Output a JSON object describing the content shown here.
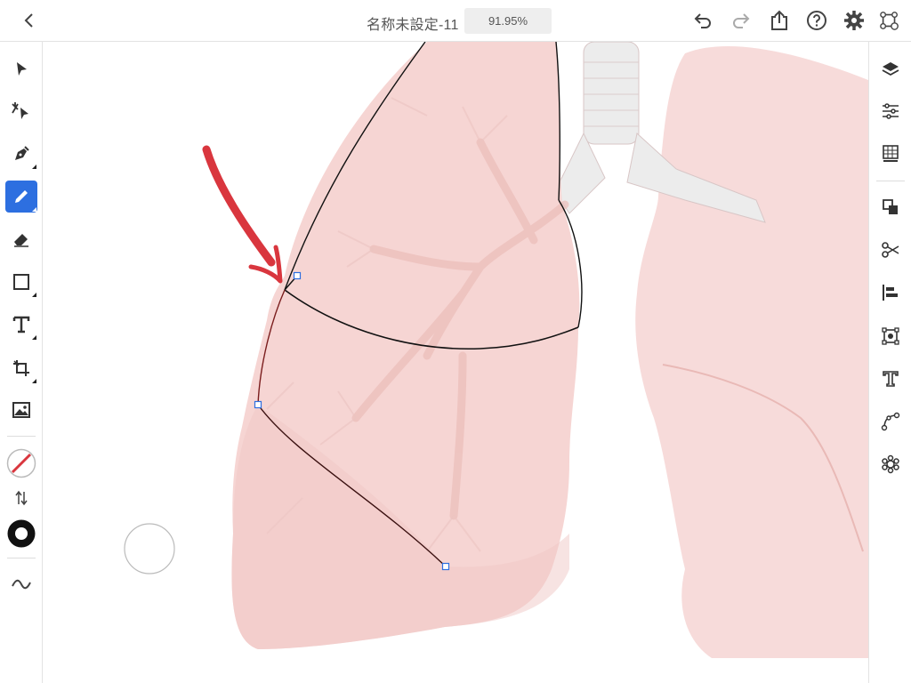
{
  "header": {
    "document_title": "名称未設定-11",
    "zoom_level": "91.95%"
  },
  "icons": {
    "top": [
      "back-chevron-icon",
      "undo-icon",
      "redo-icon",
      "share-icon",
      "help-icon",
      "settings-gear-icon",
      "touch-shortcut-icon"
    ],
    "left": [
      "selection-arrow-icon",
      "direct-selection-icon",
      "pen-icon",
      "pencil-icon",
      "eraser-icon",
      "rectangle-icon",
      "type-icon",
      "shaper-icon",
      "image-icon",
      "stroke-swatch-icon",
      "swap-colors-icon",
      "fill-swatch-icon",
      "stroke-width-icon"
    ],
    "right": [
      "layers-icon",
      "properties-icon",
      "transform-grid-icon",
      "arrange-icon",
      "pathfinder-scissors-icon",
      "align-icon",
      "trace-image-icon",
      "type-panel-icon",
      "path-icon",
      "repeat-icon"
    ]
  },
  "colors": {
    "active_tool": "#2d6fe0",
    "annotation_arrow": "#d9363e",
    "lung_fill": "#f6d5d3",
    "path_stroke": "#111111",
    "anchor_point": "#2d6fe0"
  }
}
